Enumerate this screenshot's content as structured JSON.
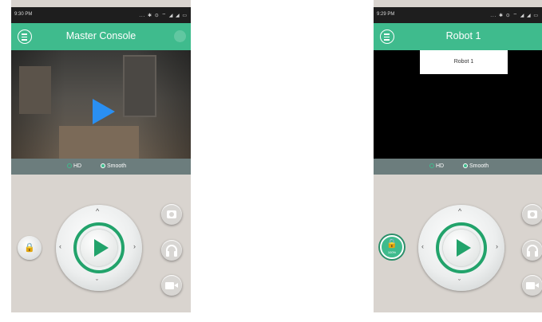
{
  "left": {
    "status": {
      "time": "9:30 PM",
      "icons": "... ✱ ⊙ ⌔ ◢ ◢ ▭"
    },
    "title": "Master Console",
    "quality": {
      "hd": "HD",
      "smooth": "Smooth"
    },
    "lock_label": "🔒"
  },
  "right": {
    "status": {
      "time": "9:29 PM",
      "icons": "... ✱ ⊙ ⌔ ◢ ◢ ▭"
    },
    "title": "Robot 1",
    "dropdown_option": "Robot 1",
    "quality": {
      "hd": "HD",
      "smooth": "Smooth"
    },
    "lock_label": "🔒",
    "lock_percent": "100%"
  },
  "icons": {
    "menu": "menu-icon",
    "play": "play-icon",
    "camera": "camera-icon",
    "headphones": "headphones-icon",
    "video": "video-camera-icon",
    "lock": "lock-icon"
  },
  "colors": {
    "accent": "#3fbb8d",
    "play_button": "#2a8ff2",
    "ring": "#22a36b",
    "panel": "#d9d4cf"
  }
}
